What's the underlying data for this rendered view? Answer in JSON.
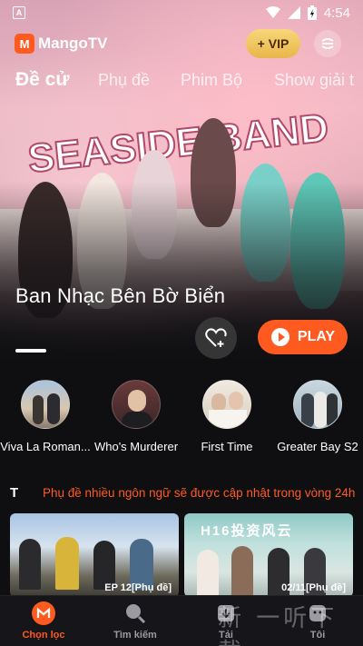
{
  "status_bar": {
    "left_badge": "A",
    "time": "4:54"
  },
  "header": {
    "brand": "MangoTV",
    "vip_label": "+ VIP"
  },
  "tabs": [
    {
      "label": "Đề cử",
      "active": true
    },
    {
      "label": "Phụ đề",
      "active": false
    },
    {
      "label": "Phim Bộ",
      "active": false
    },
    {
      "label": "Show giải t",
      "active": false
    }
  ],
  "hero": {
    "art_title": "SEASIDE BAND",
    "title": "Ban Nhạc Bên Bờ Biển",
    "play_label": "PLAY",
    "slide_index": 1
  },
  "shows": [
    {
      "label": "Viva La Roman..."
    },
    {
      "label": "Who's Murderer"
    },
    {
      "label": "First Time"
    },
    {
      "label": "Greater Bay S2"
    }
  ],
  "notice": {
    "icon_text": "T",
    "text": "Phụ đề nhiều ngôn ngữ sẽ được cập nhật trong vòng 24h"
  },
  "thumbnails": [
    {
      "badge": "EP 12[Phụ đề]"
    },
    {
      "title_art": "H16投资风云",
      "badge": "02/11[Phụ đề]"
    }
  ],
  "bottom_nav": [
    {
      "label": "Chọn lọc",
      "icon": "mango-home-icon",
      "active": true
    },
    {
      "label": "Tìm kiếm",
      "icon": "search-icon",
      "active": false
    },
    {
      "label": "Tải",
      "icon": "download-icon",
      "active": false
    },
    {
      "label": "Tôi",
      "icon": "profile-icon",
      "active": false
    }
  ],
  "watermark": "新 一听下载",
  "colors": {
    "accent": "#ff5a1f",
    "vip_gold": "#f0c35c",
    "background": "#0f0f12"
  }
}
